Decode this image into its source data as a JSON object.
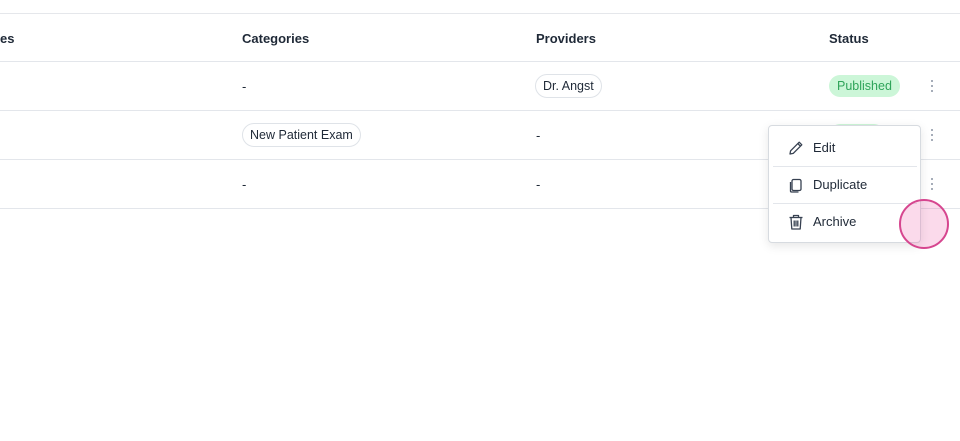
{
  "table": {
    "headers": [
      "es",
      "Categories",
      "Providers",
      "Status"
    ],
    "rows": [
      {
        "category": "-",
        "provider": "Dr. Angst",
        "status": "Published"
      },
      {
        "category": "New Patient Exam",
        "provider": "-",
        "status": ""
      },
      {
        "category": "-",
        "provider": "-",
        "status": ""
      }
    ]
  },
  "menu": {
    "items": [
      {
        "label": "Edit",
        "icon": "pencil-icon"
      },
      {
        "label": "Duplicate",
        "icon": "copy-icon"
      },
      {
        "label": "Archive",
        "icon": "trash-icon"
      }
    ]
  },
  "colors": {
    "published_bg": "#ccf6d8",
    "published_text": "#2fa45a",
    "divider": "#e3e6eb",
    "click_indicator": "#d6468f"
  }
}
